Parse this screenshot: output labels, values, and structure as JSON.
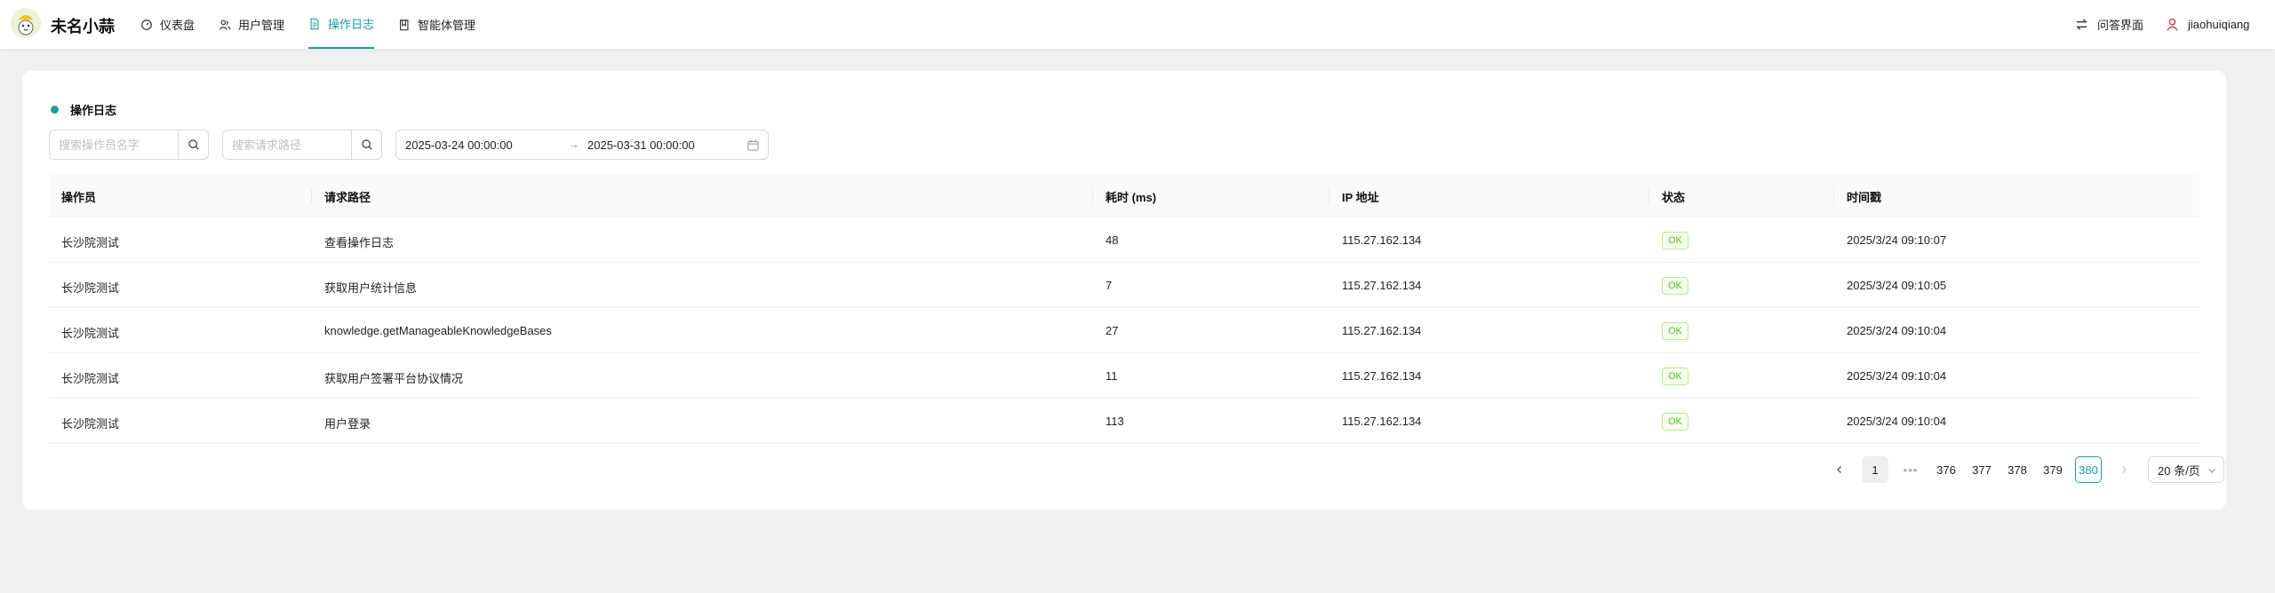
{
  "app": {
    "brand": "未名小蒜",
    "nav": [
      {
        "label": "仪表盘",
        "icon": "dashboard-icon"
      },
      {
        "label": "用户管理",
        "icon": "users-icon"
      },
      {
        "label": "操作日志",
        "icon": "document-icon",
        "active": true
      },
      {
        "label": "智能体管理",
        "icon": "book-icon"
      }
    ],
    "qa_label": "问答界面",
    "username": "jiaohuiqiang"
  },
  "page": {
    "title": "操作日志",
    "search_operator_placeholder": "搜索操作员名字",
    "search_path_placeholder": "搜索请求路径",
    "date_start": "2025-03-24 00:00:00",
    "date_arrow": "→",
    "date_end": "2025-03-31 00:00:00"
  },
  "table": {
    "headers": [
      "操作员",
      "请求路径",
      "耗时 (ms)",
      "IP 地址",
      "状态",
      "时间戳"
    ],
    "rows": [
      {
        "operator": "长沙院测试",
        "path": "查看操作日志",
        "duration": "48",
        "ip": "115.27.162.134",
        "status": "OK",
        "time": "2025/3/24 09:10:07"
      },
      {
        "operator": "长沙院测试",
        "path": "获取用户统计信息",
        "duration": "7",
        "ip": "115.27.162.134",
        "status": "OK",
        "time": "2025/3/24 09:10:05"
      },
      {
        "operator": "长沙院测试",
        "path": "knowledge.getManageableKnowledgeBases",
        "duration": "27",
        "ip": "115.27.162.134",
        "status": "OK",
        "time": "2025/3/24 09:10:04"
      },
      {
        "operator": "长沙院测试",
        "path": "获取用户签署平台协议情况",
        "duration": "11",
        "ip": "115.27.162.134",
        "status": "OK",
        "time": "2025/3/24 09:10:04"
      },
      {
        "operator": "长沙院测试",
        "path": "用户登录",
        "duration": "113",
        "ip": "115.27.162.134",
        "status": "OK",
        "time": "2025/3/24 09:10:04"
      }
    ]
  },
  "pagination": {
    "pages": [
      "1",
      "•••",
      "376",
      "377",
      "378",
      "379",
      "380"
    ],
    "current": "380",
    "page_size": "20 条/页"
  },
  "colors": {
    "accent": "#1a9e9e",
    "ok_tag_text": "#52c41a",
    "background": "#f0f0f1"
  }
}
